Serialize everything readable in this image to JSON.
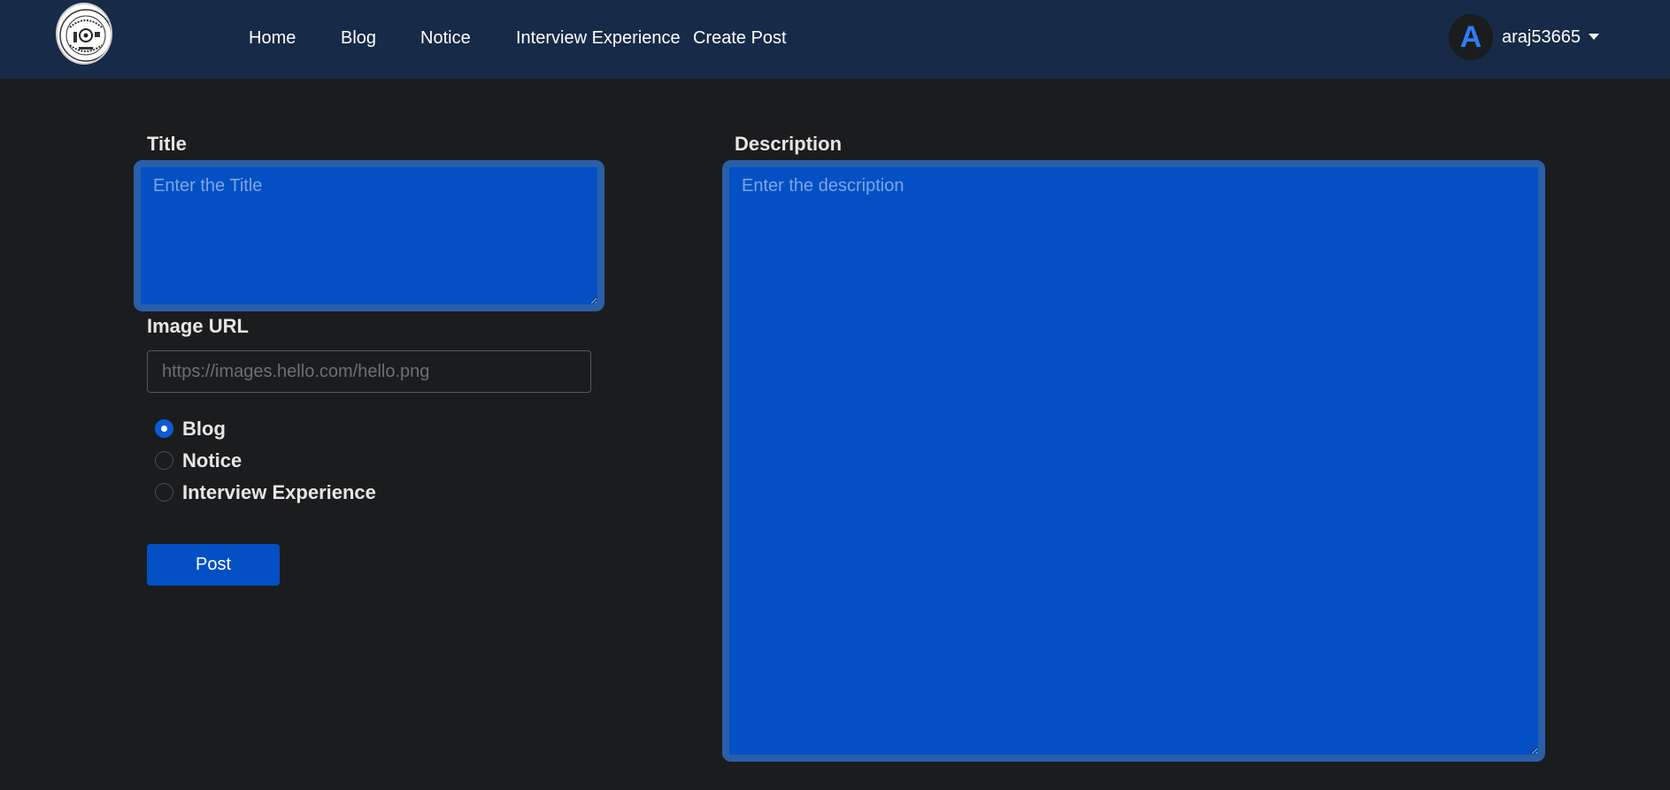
{
  "nav": {
    "logo_icon": "college-emblem-icon",
    "links": [
      "Home",
      "Blog",
      "Notice",
      "Interview Experience",
      "Create Post"
    ]
  },
  "user": {
    "avatar_initial": "A",
    "username": "araj53665",
    "menu_icon": "caret-down-icon"
  },
  "form": {
    "title_label": "Title",
    "title_placeholder": "Enter the Title",
    "image_label": "Image URL",
    "image_placeholder": "https://images.hello.com/hello.png",
    "categories": [
      {
        "label": "Blog",
        "checked": true
      },
      {
        "label": "Notice",
        "checked": false
      },
      {
        "label": "Interview Experience",
        "checked": false
      }
    ],
    "post_label": "Post",
    "description_label": "Description",
    "description_placeholder": "Enter the description"
  },
  "colors": {
    "navbar": "#172a47",
    "background": "#1b1c1e",
    "accent": "#0350c5",
    "avatar_letter": "#2f7ff5"
  }
}
